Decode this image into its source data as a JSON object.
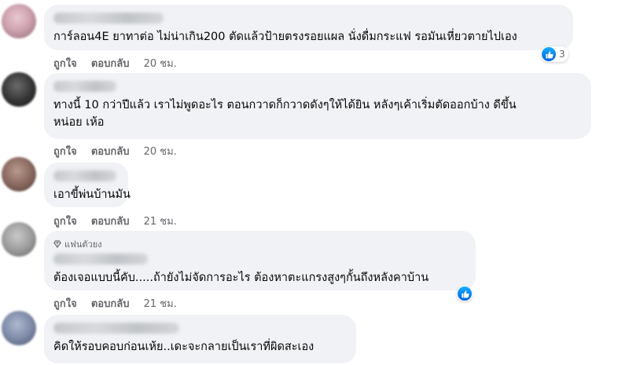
{
  "comments": [
    {
      "text_lines": [
        "การ์ลอน4E ยาทาต่อ ไม่น่าเกิน200 ตัดแล้วป้ายตรงรอยแผล นั่งดื่มกระแฟ รอมันเหี่ยวตายไปเอง"
      ],
      "like_label": "ถูกใจ",
      "reply_label": "ตอบกลับ",
      "time": "20 ชม.",
      "reaction_count": "3"
    },
    {
      "text_lines": [
        "ทางนี้ 10 กว่าปีแล้ว เราไม่พูดอะไร ตอนกวาดก็กวาดดังๆให้ได้ยิน หลังๆเค้าเริ่มตัดออกบ้าง ดีขึ้น",
        "หน่อย เห้อ"
      ],
      "like_label": "ถูกใจ",
      "reply_label": "ตอบกลับ",
      "time": "20 ชม."
    },
    {
      "text_lines": [
        "เอาขี้พ่นบ้านมัน"
      ],
      "like_label": "ถูกใจ",
      "reply_label": "ตอบกลับ",
      "time": "21 ชม."
    },
    {
      "badge": "แฟนตัวยง",
      "text_lines": [
        "ต้องเจอแบบนี้คับ.....ถ้ายังไม่จัดการอะไร ต้องหาตะแกรงสูงๆกั้นถึงหลังคาบ้าน"
      ],
      "like_label": "ถูกใจ",
      "reply_label": "ตอบกลับ",
      "time": "21 ชม."
    },
    {
      "text_lines": [
        "คิดให้รอบคอบก่อนเห้ย..เดะจะกลายเป็นเราที่ผิดสะเอง"
      ]
    }
  ],
  "colors": {
    "bubble": "#f0f2f5",
    "meta": "#65676b",
    "like_blue": "#0062df"
  },
  "icons": {
    "reaction": "like-thumb-icon",
    "badge": "diamond-icon"
  }
}
